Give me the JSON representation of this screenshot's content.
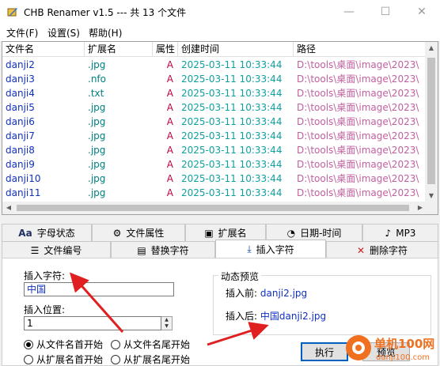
{
  "window": {
    "title": "CHB Renamer v1.5 --- 共 13 个文件",
    "min_glyph": "—",
    "max_glyph": "☐",
    "close_glyph": "✕"
  },
  "menu": [
    "文件(F)",
    "设置(S)",
    "帮助(H)"
  ],
  "table": {
    "headers": [
      "文件名",
      "扩展名",
      "属性",
      "创建时间",
      "路径"
    ],
    "rows": [
      {
        "name": "danji2",
        "ext": ".jpg",
        "attr": "A",
        "time": "2025-03-11 10:33:44",
        "path": "D:\\tools\\桌面\\image\\2023\\"
      },
      {
        "name": "danji3",
        "ext": ".nfo",
        "attr": "A",
        "time": "2025-03-11 10:33:44",
        "path": "D:\\tools\\桌面\\image\\2023\\"
      },
      {
        "name": "danji4",
        "ext": ".txt",
        "attr": "A",
        "time": "2025-03-11 10:33:44",
        "path": "D:\\tools\\桌面\\image\\2023\\"
      },
      {
        "name": "danji5",
        "ext": ".jpg",
        "attr": "A",
        "time": "2025-03-11 10:33:44",
        "path": "D:\\tools\\桌面\\image\\2023\\"
      },
      {
        "name": "danji6",
        "ext": ".jpg",
        "attr": "A",
        "time": "2025-03-11 10:33:44",
        "path": "D:\\tools\\桌面\\image\\2023\\"
      },
      {
        "name": "danji7",
        "ext": ".jpg",
        "attr": "A",
        "time": "2025-03-11 10:33:44",
        "path": "D:\\tools\\桌面\\image\\2023\\"
      },
      {
        "name": "danji8",
        "ext": ".jpg",
        "attr": "A",
        "time": "2025-03-11 10:33:44",
        "path": "D:\\tools\\桌面\\image\\2023\\"
      },
      {
        "name": "danji9",
        "ext": ".jpg",
        "attr": "A",
        "time": "2025-03-11 10:33:44",
        "path": "D:\\tools\\桌面\\image\\2023\\"
      },
      {
        "name": "danji10",
        "ext": ".jpg",
        "attr": "A",
        "time": "2025-03-11 10:33:44",
        "path": "D:\\tools\\桌面\\image\\2023\\"
      },
      {
        "name": "danji11",
        "ext": ".jpg",
        "attr": "A",
        "time": "2025-03-11 10:33:44",
        "path": "D:\\tools\\桌面\\image\\2023\\"
      }
    ]
  },
  "tabs_row1": [
    {
      "label": "字母状态",
      "icon": "Aa"
    },
    {
      "label": "文件属性",
      "icon": "⚙"
    },
    {
      "label": "扩展名",
      "icon": "▣"
    },
    {
      "label": "日期-时间",
      "icon": "◔"
    },
    {
      "label": "MP3",
      "icon": "♪"
    }
  ],
  "tabs_row2": [
    {
      "label": "文件编号",
      "icon": "☰"
    },
    {
      "label": "替换字符",
      "icon": "▤"
    },
    {
      "label": "插入字符",
      "icon": "⤓",
      "active": true
    },
    {
      "label": "删除字符",
      "icon": "✕"
    }
  ],
  "insert": {
    "text_label": "插入字符:",
    "text_value": "中国",
    "pos_label": "插入位置:",
    "pos_value": "1",
    "radios": [
      {
        "label": "从文件名首开始",
        "checked": true
      },
      {
        "label": "从文件名尾开始",
        "checked": false
      },
      {
        "label": "从扩展名首开始",
        "checked": false
      },
      {
        "label": "从扩展名尾开始",
        "checked": false
      }
    ]
  },
  "preview": {
    "title": "动态预览",
    "before_label": "插入前:",
    "before_value": "danji2.jpg",
    "after_label": "插入后:",
    "after_prefix": "中国",
    "after_value": "danji2.jpg"
  },
  "buttons": {
    "apply": "执行",
    "preview": "预览"
  },
  "watermark": {
    "text": "单机100网",
    "sub": "danji100.com"
  },
  "colors": {
    "arrow": "#e02020",
    "link": "#1030c0",
    "accent": "#0060c0"
  }
}
